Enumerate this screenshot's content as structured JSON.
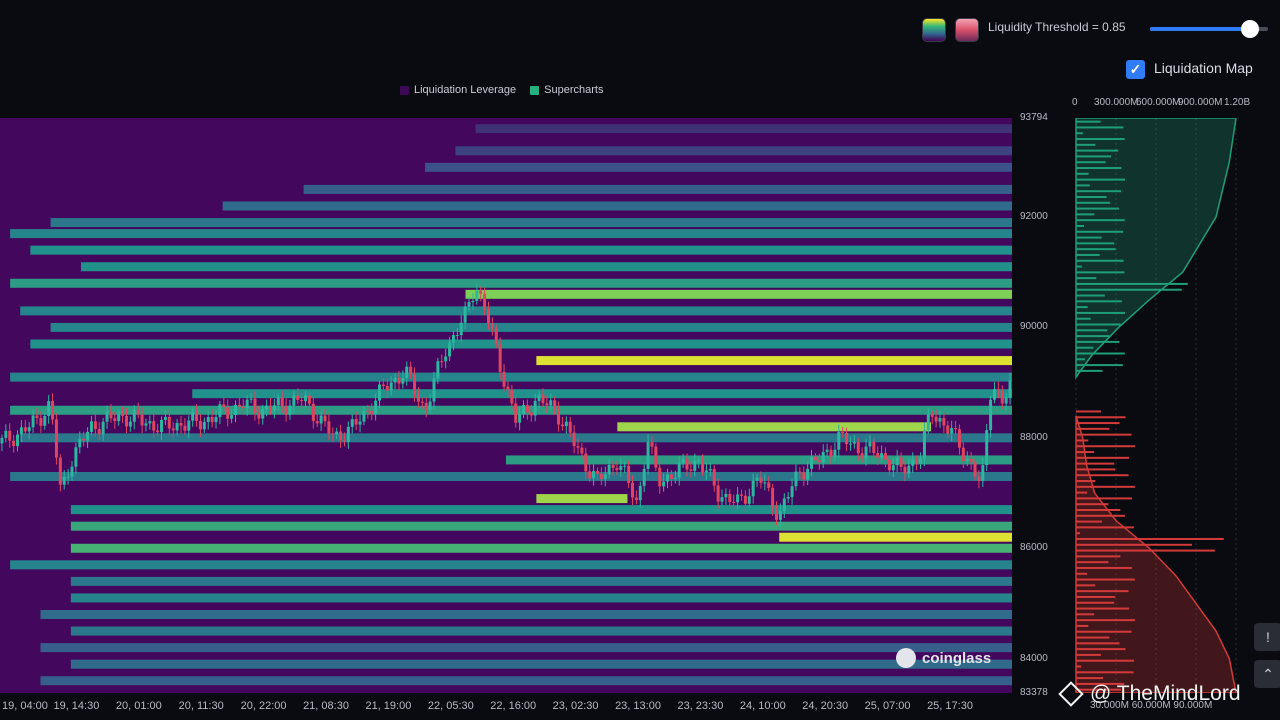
{
  "controls": {
    "threshold_label": "Liquidity Threshold = 0.85",
    "threshold_value": 0.85,
    "toggle_label": "Liquidation Map",
    "toggle_checked": true,
    "palette_icons": [
      "viridis-palette-icon",
      "rose-palette-icon"
    ]
  },
  "colors": {
    "heatmap_low": "#44075e",
    "heatmap_mid": "#21918c",
    "heatmap_high": "#fde725",
    "candle_up": "#2bb7a0",
    "candle_down": "#e0455f",
    "side_upper": "#1f9e7a",
    "side_lower": "#d33a3a"
  },
  "chart_data": {
    "type": "heatmap",
    "legend": [
      {
        "name": "Liquidation Leverage",
        "color": "#3d0a57"
      },
      {
        "name": "Supercharts",
        "color": "#26b07f"
      }
    ],
    "y_range": [
      83378,
      93794
    ],
    "y_ticks": [
      "93794",
      "92000",
      "90000",
      "88000",
      "86000",
      "84000",
      "83378"
    ],
    "x_ticks": [
      "19, 04:00",
      "19, 14:30",
      "20, 01:00",
      "20, 11:30",
      "20, 22:00",
      "21, 08:30",
      "21, 19:00",
      "22, 05:30",
      "22, 16:00",
      "23, 02:30",
      "23, 13:00",
      "23, 23:30",
      "24, 10:00",
      "24, 20:30",
      "25, 07:00",
      "25, 17:30"
    ],
    "price_path": [
      [
        0,
        87900
      ],
      [
        3,
        88200
      ],
      [
        5,
        88600
      ],
      [
        6,
        87000
      ],
      [
        7,
        87600
      ],
      [
        9,
        88200
      ],
      [
        12,
        88400
      ],
      [
        16,
        88200
      ],
      [
        20,
        88300
      ],
      [
        24,
        88600
      ],
      [
        26,
        88500
      ],
      [
        30,
        88700
      ],
      [
        33,
        88000
      ],
      [
        35,
        88200
      ],
      [
        38,
        88900
      ],
      [
        40,
        89200
      ],
      [
        42,
        88500
      ],
      [
        44,
        89600
      ],
      [
        46,
        90200
      ],
      [
        47,
        90800
      ],
      [
        48,
        90300
      ],
      [
        49,
        89600
      ],
      [
        51,
        88300
      ],
      [
        53,
        88700
      ],
      [
        55,
        88500
      ],
      [
        57,
        87800
      ],
      [
        59,
        87200
      ],
      [
        61,
        87600
      ],
      [
        63,
        86800
      ],
      [
        64,
        88000
      ],
      [
        65,
        87200
      ],
      [
        67,
        87400
      ],
      [
        69,
        87600
      ],
      [
        71,
        87000
      ],
      [
        73,
        86800
      ],
      [
        75,
        87300
      ],
      [
        77,
        86600
      ],
      [
        79,
        87400
      ],
      [
        81,
        87600
      ],
      [
        83,
        88000
      ],
      [
        85,
        87800
      ],
      [
        87,
        87700
      ],
      [
        89,
        87400
      ],
      [
        91,
        87700
      ],
      [
        92,
        88500
      ],
      [
        94,
        88100
      ],
      [
        96,
        87500
      ],
      [
        97,
        87100
      ],
      [
        98,
        89100
      ],
      [
        99,
        88600
      ],
      [
        100,
        89000
      ]
    ],
    "liquidity_bands": [
      {
        "y": 93600,
        "start": 47,
        "end": 100,
        "level": 0.15
      },
      {
        "y": 93200,
        "start": 45,
        "end": 100,
        "level": 0.2
      },
      {
        "y": 92900,
        "start": 42,
        "end": 100,
        "level": 0.25
      },
      {
        "y": 92500,
        "start": 30,
        "end": 100,
        "level": 0.3
      },
      {
        "y": 92200,
        "start": 22,
        "end": 100,
        "level": 0.35
      },
      {
        "y": 91900,
        "start": 5,
        "end": 100,
        "level": 0.4
      },
      {
        "y": 91700,
        "start": 1,
        "end": 100,
        "level": 0.45
      },
      {
        "y": 91400,
        "start": 3,
        "end": 100,
        "level": 0.5
      },
      {
        "y": 91100,
        "start": 8,
        "end": 100,
        "level": 0.5
      },
      {
        "y": 90800,
        "start": 1,
        "end": 100,
        "level": 0.55
      },
      {
        "y": 90600,
        "start": 46,
        "end": 100,
        "level": 0.8
      },
      {
        "y": 90300,
        "start": 2,
        "end": 100,
        "level": 0.45
      },
      {
        "y": 90000,
        "start": 5,
        "end": 100,
        "level": 0.45
      },
      {
        "y": 89700,
        "start": 3,
        "end": 100,
        "level": 0.5
      },
      {
        "y": 89400,
        "start": 53,
        "end": 100,
        "level": 0.95
      },
      {
        "y": 89100,
        "start": 1,
        "end": 100,
        "level": 0.45
      },
      {
        "y": 88800,
        "start": 19,
        "end": 100,
        "level": 0.5
      },
      {
        "y": 88500,
        "start": 1,
        "end": 100,
        "level": 0.55
      },
      {
        "y": 88200,
        "start": 61,
        "end": 92,
        "level": 0.85
      },
      {
        "y": 88000,
        "start": 2,
        "end": 100,
        "level": 0.4
      },
      {
        "y": 87600,
        "start": 50,
        "end": 100,
        "level": 0.55
      },
      {
        "y": 87300,
        "start": 1,
        "end": 100,
        "level": 0.4
      },
      {
        "y": 86900,
        "start": 53,
        "end": 62,
        "level": 0.85
      },
      {
        "y": 86700,
        "start": 7,
        "end": 100,
        "level": 0.5
      },
      {
        "y": 86400,
        "start": 7,
        "end": 100,
        "level": 0.6
      },
      {
        "y": 86200,
        "start": 77,
        "end": 100,
        "level": 0.95
      },
      {
        "y": 86000,
        "start": 7,
        "end": 100,
        "level": 0.65
      },
      {
        "y": 85700,
        "start": 1,
        "end": 100,
        "level": 0.45
      },
      {
        "y": 85400,
        "start": 7,
        "end": 100,
        "level": 0.4
      },
      {
        "y": 85100,
        "start": 7,
        "end": 100,
        "level": 0.45
      },
      {
        "y": 84800,
        "start": 4,
        "end": 100,
        "level": 0.35
      },
      {
        "y": 84500,
        "start": 7,
        "end": 100,
        "level": 0.4
      },
      {
        "y": 84200,
        "start": 4,
        "end": 100,
        "level": 0.3
      },
      {
        "y": 83900,
        "start": 7,
        "end": 100,
        "level": 0.35
      },
      {
        "y": 83600,
        "start": 4,
        "end": 100,
        "level": 0.3
      }
    ],
    "side_axis_labels": [
      "0",
      "300.000M",
      "600.000M",
      "900.000M",
      "1.20B"
    ],
    "side_bottom_labels": [
      "30.000M",
      "60.000M",
      "90.000M"
    ],
    "cumulative_upper": [
      [
        93794,
        1.2
      ],
      [
        93000,
        1.15
      ],
      [
        92000,
        1.05
      ],
      [
        91000,
        0.8
      ],
      [
        90500,
        0.55
      ],
      [
        90000,
        0.32
      ],
      [
        89500,
        0.12
      ],
      [
        89100,
        0.0
      ]
    ],
    "cumulative_lower": [
      [
        88400,
        0.0
      ],
      [
        88000,
        0.05
      ],
      [
        87500,
        0.08
      ],
      [
        87000,
        0.14
      ],
      [
        86500,
        0.3
      ],
      [
        86000,
        0.55
      ],
      [
        85500,
        0.75
      ],
      [
        85000,
        0.9
      ],
      [
        84500,
        1.05
      ],
      [
        84000,
        1.15
      ],
      [
        83378,
        1.2
      ]
    ]
  },
  "watermarks": {
    "coinglass": "coinglass",
    "author": "@ TheMindLord"
  }
}
